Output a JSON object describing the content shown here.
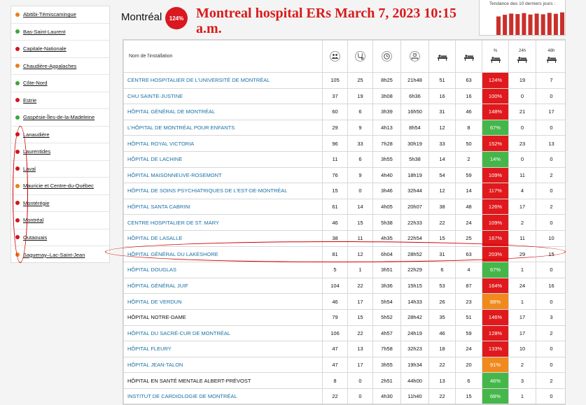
{
  "sidebar": {
    "items": [
      {
        "label": "Abitibi-Témiscamingue",
        "color": "#e8811a"
      },
      {
        "label": "Bas-Saint-Laurent",
        "color": "#3aa835"
      },
      {
        "label": "Capitale-Nationale",
        "color": "#d0161d"
      },
      {
        "label": "Chaudière-Appalaches",
        "color": "#e8811a"
      },
      {
        "label": "Côte-Nord",
        "color": "#3aa835"
      },
      {
        "label": "Estrie",
        "color": "#d0161d"
      },
      {
        "label": "Gaspésie-Îles-de-la-Madeleine",
        "color": "#3aa835"
      },
      {
        "label": "Lanaudière",
        "color": "#d0161d"
      },
      {
        "label": "Laurentides",
        "color": "#d0161d"
      },
      {
        "label": "Laval",
        "color": "#d0161d"
      },
      {
        "label": "Mauricie et Centre-du-Québec",
        "color": "#e8811a"
      },
      {
        "label": "Montérégie",
        "color": "#d0161d"
      },
      {
        "label": "Montréal",
        "color": "#d0161d"
      },
      {
        "label": "Outaouais",
        "color": "#d0161d"
      },
      {
        "label": "Saguenay–Lac-Saint-Jean",
        "color": "#e8811a"
      }
    ]
  },
  "header": {
    "region": "Montréal",
    "occupancy": "124%",
    "headline": "Montreal hospital ERs March 7, 2023 10:15 a.m.",
    "trend_title": "Tendance des 10 derniers jours :",
    "trend_values": [
      0.78,
      0.85,
      0.9,
      0.88,
      0.92,
      0.86,
      0.9,
      0.87,
      0.93,
      0.89,
      0.95,
      0.9
    ],
    "trend_color": "#c9302c"
  },
  "table": {
    "name_header": "Nom de l'installation",
    "columns": [
      {
        "icon": "people-icon",
        "label": ""
      },
      {
        "icon": "stethoscope-icon",
        "label": ""
      },
      {
        "icon": "clock-icon",
        "label": ""
      },
      {
        "icon": "clock-stretcher-icon",
        "label": ""
      },
      {
        "icon": "stretcher-icon",
        "label": ""
      },
      {
        "icon": "stretcher-capacity-icon",
        "label": ""
      },
      {
        "icon": "stretcher-percent-icon",
        "label": "%"
      },
      {
        "icon": "stretcher-24h-icon",
        "label": "24h"
      },
      {
        "icon": "stretcher-48h-icon",
        "label": "48h"
      }
    ],
    "rows": [
      {
        "name": "CENTRE HOSPITALIER DE L'UNIVERSITÉ DE MONTRÉAL",
        "link": true,
        "c1": "105",
        "c2": "25",
        "c3": "8h25",
        "c4": "21h48",
        "c5": "51",
        "c6": "63",
        "pct": "124%",
        "pct_color": "#e0191c",
        "c8": "19",
        "c9": "7"
      },
      {
        "name": "CHU SAINTE-JUSTINE",
        "link": true,
        "c1": "37",
        "c2": "19",
        "c3": "3h08",
        "c4": "6h36",
        "c5": "16",
        "c6": "16",
        "pct": "100%",
        "pct_color": "#e0191c",
        "c8": "0",
        "c9": "0"
      },
      {
        "name": "HÔPITAL GÉNÉRAL DE MONTRÉAL",
        "link": true,
        "c1": "60",
        "c2": "6",
        "c3": "3h39",
        "c4": "16h50",
        "c5": "31",
        "c6": "46",
        "pct": "148%",
        "pct_color": "#e0191c",
        "c8": "21",
        "c9": "17"
      },
      {
        "name": "L'HÔPITAL DE MONTRÉAL POUR ENFANTS",
        "link": true,
        "c1": "29",
        "c2": "9",
        "c3": "4h13",
        "c4": "8h54",
        "c5": "12",
        "c6": "8",
        "pct": "67%",
        "pct_color": "#45b74a",
        "c8": "0",
        "c9": "0"
      },
      {
        "name": "HÔPITAL ROYAL VICTORIA",
        "link": true,
        "c1": "96",
        "c2": "33",
        "c3": "7h28",
        "c4": "30h19",
        "c5": "33",
        "c6": "50",
        "pct": "152%",
        "pct_color": "#e0191c",
        "c8": "23",
        "c9": "13"
      },
      {
        "name": "HÔPITAL DE LACHINE",
        "link": true,
        "c1": "11",
        "c2": "6",
        "c3": "3h55",
        "c4": "5h38",
        "c5": "14",
        "c6": "2",
        "pct": "14%",
        "pct_color": "#45b74a",
        "c8": "0",
        "c9": "0"
      },
      {
        "name": "HÔPITAL MAISONNEUVE-ROSEMONT",
        "link": true,
        "c1": "76",
        "c2": "9",
        "c3": "4h40",
        "c4": "18h19",
        "c5": "54",
        "c6": "59",
        "pct": "109%",
        "pct_color": "#e0191c",
        "c8": "11",
        "c9": "2"
      },
      {
        "name": "HÔPITAL DE SOINS PSYCHIATRIQUES DE L'EST-DE-MONTRÉAL",
        "link": true,
        "c1": "15",
        "c2": "0",
        "c3": "3h46",
        "c4": "32h44",
        "c5": "12",
        "c6": "14",
        "pct": "117%",
        "pct_color": "#e0191c",
        "c8": "4",
        "c9": "0"
      },
      {
        "name": "HÔPITAL SANTA CABRINI",
        "link": true,
        "c1": "61",
        "c2": "14",
        "c3": "4h05",
        "c4": "20h07",
        "c5": "38",
        "c6": "48",
        "pct": "126%",
        "pct_color": "#e0191c",
        "c8": "17",
        "c9": "2"
      },
      {
        "name": "CENTRE HOSPITALIER DE ST. MARY",
        "link": true,
        "c1": "46",
        "c2": "15",
        "c3": "5h38",
        "c4": "22h33",
        "c5": "22",
        "c6": "24",
        "pct": "109%",
        "pct_color": "#e0191c",
        "c8": "2",
        "c9": "0"
      },
      {
        "name": "HÔPITAL DE LASALLE",
        "link": true,
        "c1": "38",
        "c2": "11",
        "c3": "4h35",
        "c4": "22h54",
        "c5": "15",
        "c6": "25",
        "pct": "167%",
        "pct_color": "#e0191c",
        "c8": "11",
        "c9": "10"
      },
      {
        "name": "HÔPITAL GÉNÉRAL DU LAKESHORE",
        "link": true,
        "c1": "81",
        "c2": "12",
        "c3": "6h04",
        "c4": "28h52",
        "c5": "31",
        "c6": "63",
        "pct": "203%",
        "pct_color": "#e0191c",
        "c8": "29",
        "c9": "15"
      },
      {
        "name": "HÔPITAL DOUGLAS",
        "link": true,
        "c1": "5",
        "c2": "1",
        "c3": "3h51",
        "c4": "22h29",
        "c5": "6",
        "c6": "4",
        "pct": "67%",
        "pct_color": "#45b74a",
        "c8": "1",
        "c9": "0"
      },
      {
        "name": "HÔPITAL GÉNÉRAL JUIF",
        "link": true,
        "c1": "104",
        "c2": "22",
        "c3": "3h36",
        "c4": "15h15",
        "c5": "53",
        "c6": "87",
        "pct": "164%",
        "pct_color": "#e0191c",
        "c8": "24",
        "c9": "16"
      },
      {
        "name": "HÔPITAL DE VERDUN",
        "link": true,
        "c1": "46",
        "c2": "17",
        "c3": "5h54",
        "c4": "14h33",
        "c5": "26",
        "c6": "23",
        "pct": "88%",
        "pct_color": "#f08a1f",
        "c8": "1",
        "c9": "0"
      },
      {
        "name": "HÔPITAL NOTRE-DAME",
        "link": false,
        "c1": "79",
        "c2": "15",
        "c3": "5h52",
        "c4": "28h42",
        "c5": "35",
        "c6": "51",
        "pct": "146%",
        "pct_color": "#e0191c",
        "c8": "17",
        "c9": "3"
      },
      {
        "name": "HÔPITAL DU SACRÉ-CUR DE MONTRÉAL",
        "link": true,
        "c1": "106",
        "c2": "22",
        "c3": "4h57",
        "c4": "24h19",
        "c5": "46",
        "c6": "59",
        "pct": "128%",
        "pct_color": "#e0191c",
        "c8": "17",
        "c9": "2"
      },
      {
        "name": "HÔPITAL FLEURY",
        "link": true,
        "c1": "47",
        "c2": "13",
        "c3": "7h58",
        "c4": "32h23",
        "c5": "18",
        "c6": "24",
        "pct": "133%",
        "pct_color": "#e0191c",
        "c8": "10",
        "c9": "0"
      },
      {
        "name": "HÔPITAL JEAN-TALON",
        "link": true,
        "c1": "47",
        "c2": "17",
        "c3": "3h55",
        "c4": "19h34",
        "c5": "22",
        "c6": "20",
        "pct": "91%",
        "pct_color": "#f08a1f",
        "c8": "2",
        "c9": "0"
      },
      {
        "name": "HÔPITAL EN SANTÉ MENTALE ALBERT-PRÉVOST",
        "link": false,
        "c1": "8",
        "c2": "0",
        "c3": "2h51",
        "c4": "44h00",
        "c5": "13",
        "c6": "6",
        "pct": "46%",
        "pct_color": "#45b74a",
        "c8": "3",
        "c9": "2"
      },
      {
        "name": "INSTITUT DE CARDIOLOGIE DE MONTRÉAL",
        "link": true,
        "c1": "22",
        "c2": "0",
        "c3": "4h30",
        "c4": "11h40",
        "c5": "22",
        "c6": "15",
        "pct": "68%",
        "pct_color": "#45b74a",
        "c8": "1",
        "c9": "0"
      }
    ]
  }
}
